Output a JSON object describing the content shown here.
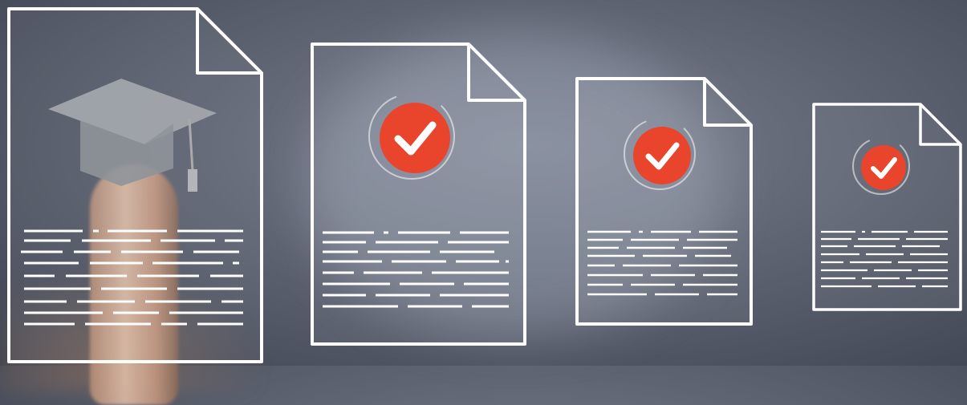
{
  "scene": {
    "description_icons": [
      "graduation-cap-icon",
      "checkmark-icon",
      "checkmark-icon",
      "checkmark-icon"
    ],
    "colors": {
      "background": "#5e6472",
      "outline": "#ffffff",
      "check_badge": "#e8452c",
      "cap": "#9a9ea6"
    }
  }
}
